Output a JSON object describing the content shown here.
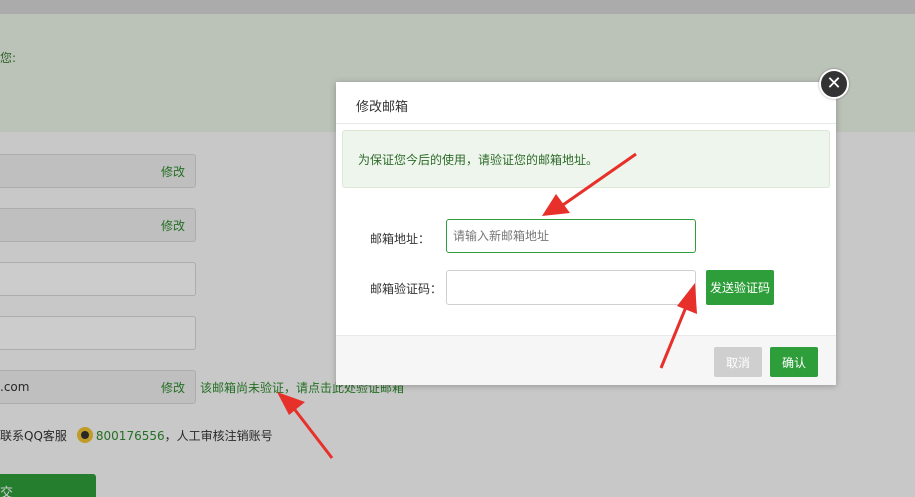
{
  "background": {
    "notice_text": "您:",
    "fields": [
      {
        "value": "",
        "link": "修改",
        "style": "gray"
      },
      {
        "value": "",
        "link": "修改",
        "style": "gray"
      },
      {
        "value": "",
        "link": "",
        "style": "white"
      },
      {
        "value": "",
        "link": "",
        "style": "white"
      },
      {
        "value": ".com",
        "link": "修改",
        "style": "gray"
      }
    ],
    "verify_note": "该邮箱尚未验证，请点击此处验证邮箱",
    "qq_prefix": "联系QQ客服",
    "qq_number": "800176556",
    "qq_suffix": "，人工审核注销账号",
    "submit_label": "交"
  },
  "modal": {
    "title": "修改邮箱",
    "close_glyph": "✕",
    "alert_text": "为保证您今后的使用，请验证您的邮箱地址。",
    "email_label": "邮箱地址：",
    "email_placeholder": "请输入新邮箱地址",
    "code_label": "邮箱验证码：",
    "code_value": "",
    "send_code_label": "发送验证码",
    "cancel_label": "取消",
    "confirm_label": "确认"
  },
  "colors": {
    "accent": "#2e9e3a",
    "annotation": "#e8302a"
  }
}
